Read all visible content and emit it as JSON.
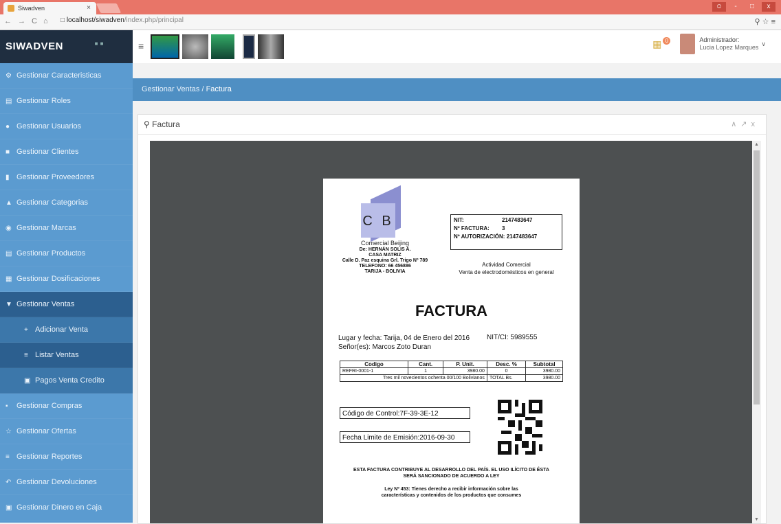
{
  "browser": {
    "tab_title": "Siwadven",
    "tab_close": "×",
    "url_host": "localhost/siwadven",
    "url_path": "/index.php/principal",
    "window_buttons": [
      "-",
      "□",
      "x"
    ]
  },
  "sidebar": {
    "brand": "SIWADVEN",
    "items": [
      {
        "label": "Gestionar Caracteristicas",
        "icon": "sliders-icon"
      },
      {
        "label": "Gestionar Roles",
        "icon": "list-icon"
      },
      {
        "label": "Gestionar Usuarios",
        "icon": "users-icon"
      },
      {
        "label": "Gestionar Clientes",
        "icon": "briefcase-icon"
      },
      {
        "label": "Gestionar Proveedores",
        "icon": "truck-icon"
      },
      {
        "label": "Gestionar Categorias",
        "icon": "sitemap-icon"
      },
      {
        "label": "Gestionar Marcas",
        "icon": "tag-icon"
      },
      {
        "label": "Gestionar Productos",
        "icon": "box-icon"
      },
      {
        "label": "Gestionar Dosificaciones",
        "icon": "file-icon"
      },
      {
        "label": "Gestionar Ventas",
        "icon": "cart-icon"
      },
      {
        "label": "Adicionar Venta",
        "icon": "plus-icon"
      },
      {
        "label": "Listar Ventas",
        "icon": "list-icon"
      },
      {
        "label": "Pagos Venta Credito",
        "icon": "money-icon"
      },
      {
        "label": "Gestionar Compras",
        "icon": "bag-icon"
      },
      {
        "label": "Gestionar Ofertas",
        "icon": "star-icon"
      },
      {
        "label": "Gestionar Reportes",
        "icon": "report-icon"
      },
      {
        "label": "Gestionar Devoluciones",
        "icon": "return-icon"
      },
      {
        "label": "Gestionar Dinero en Caja",
        "icon": "cash-icon"
      }
    ]
  },
  "header": {
    "notification_count": "0",
    "user_role": "Administrador:",
    "user_name": "Lucia Lopez Marques"
  },
  "breadcrumb": {
    "parent": "Gestionar Ventas",
    "separator": "/",
    "current": "Factura"
  },
  "panel": {
    "title": "Factura"
  },
  "invoice": {
    "logo_letters": "C B",
    "company_name": "Comercial Beijing",
    "owner": "De: HERNÁN SOLIS A.",
    "branch": "CASA MATRIZ",
    "address": "Calle D. Paz esquina Grl. Trigo Nº 789",
    "phone": "TELEFONO: 66 456886",
    "city": "TARIJA - BOLIVIA",
    "nit_label": "NIT:",
    "nit_value": "2147483647",
    "factura_label": "Nº FACTURA:",
    "factura_value": "3",
    "autorizacion_label": "Nº AUTORIZACIÓN:",
    "autorizacion_value": "2147483647",
    "activity_title": "Actividad Comercial",
    "activity_desc": "Venta de electrodomésticos en general",
    "title": "FACTURA",
    "lugar_fecha": "Lugar y fecha: Tarija, 04 de Enero del 2016",
    "senor": "Señor(es): Marcos Zoto Duran",
    "nit_ci": "NIT/CI: 5989555",
    "table_headers": [
      "Codigo",
      "Cant.",
      "P. Unit.",
      "Desc. %",
      "Subtotal"
    ],
    "table_row": [
      "REFRI-0001-1",
      "1",
      "3980.00",
      "0",
      "3980.00"
    ],
    "total_words": "Tres mil novecientos ochenta 00/100 Bolivianos",
    "total_label": "TOTAL Bs.",
    "total_value": "3980.00",
    "codigo_control": "Código de Control:7F-39-3E-12",
    "fecha_limite": "Fecha Limite de Emisión:2016-09-30",
    "footer_note": "ESTA FACTURA CONTRIBUYE AL DESARROLLO DEL PAÍS. EL USO ILÍCITO DE ÉSTA SERÁ SANCIONADO DE ACUERDO A LEY",
    "law_note": "Ley Nº 453: Tienes derecho a recibir información sobre las características y contenidos de los productos que consumes"
  }
}
